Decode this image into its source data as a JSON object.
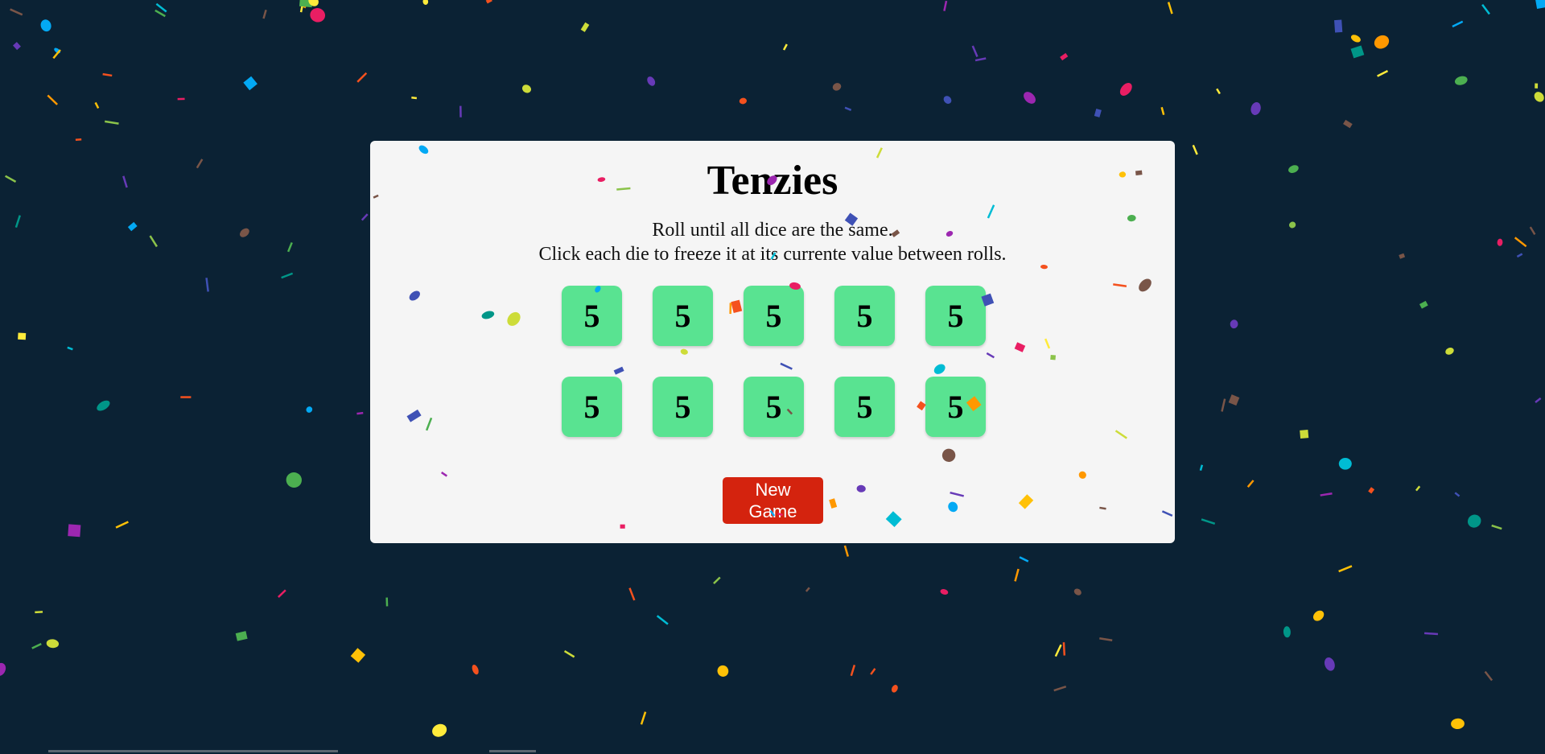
{
  "app": {
    "title": "Tenzies",
    "instructions": [
      "Roll until all dice are the same.",
      "Click each die to freeze it at its currente value between rolls."
    ],
    "button_label": "New Game"
  },
  "dice": [
    {
      "value": "5",
      "held": true
    },
    {
      "value": "5",
      "held": true
    },
    {
      "value": "5",
      "held": true
    },
    {
      "value": "5",
      "held": true
    },
    {
      "value": "5",
      "held": true
    },
    {
      "value": "5",
      "held": true
    },
    {
      "value": "5",
      "held": true
    },
    {
      "value": "5",
      "held": true
    },
    {
      "value": "5",
      "held": true
    },
    {
      "value": "5",
      "held": true
    }
  ],
  "colors": {
    "background": "#0b2234",
    "board": "#f5f5f5",
    "die_held": "#59e391",
    "button": "#d4230e",
    "confetti": [
      "#f4511e",
      "#03a9f4",
      "#4caf50",
      "#ffeb3b",
      "#9c27b0",
      "#e91e63",
      "#009688",
      "#ff9800",
      "#3f51b5",
      "#cddc39",
      "#795548",
      "#00bcd4",
      "#ffc107",
      "#673ab7",
      "#8bc34a"
    ]
  }
}
